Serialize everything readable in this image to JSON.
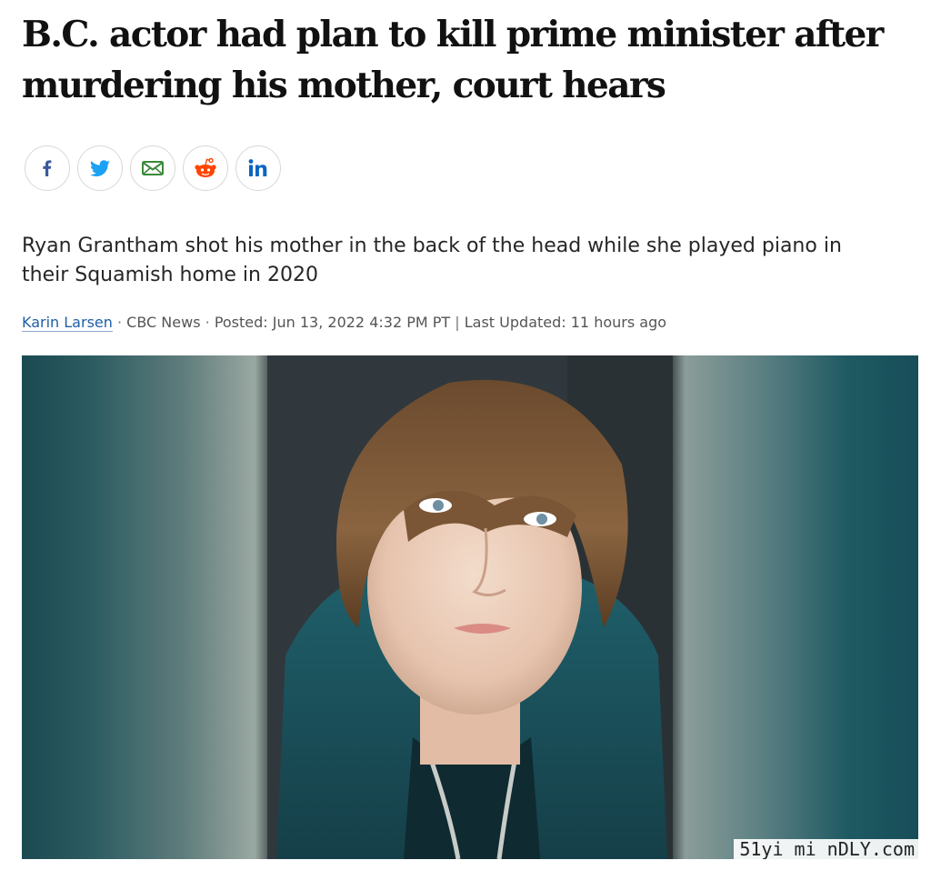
{
  "article": {
    "headline": "B.C. actor had plan to kill prime minister after murdering his mother, court hears",
    "dek": "Ryan Grantham shot his mother in the back of the head while she played piano in their Squamish home in 2020",
    "byline": {
      "author": "Karin Larsen",
      "separator_dot": "·",
      "source": "CBC News",
      "posted": "Posted: Jun 13, 2022 4:32 PM PT",
      "pipe": "|",
      "updated": "Last Updated: 11 hours ago"
    }
  },
  "share": {
    "buttons": [
      {
        "network": "facebook",
        "icon": "facebook-icon",
        "color": "#3b5998"
      },
      {
        "network": "twitter",
        "icon": "twitter-icon",
        "color": "#1da1f2"
      },
      {
        "network": "email",
        "icon": "email-icon",
        "color": "#3a8a3a"
      },
      {
        "network": "reddit",
        "icon": "reddit-icon",
        "color": "#ff4500"
      },
      {
        "network": "linkedin",
        "icon": "linkedin-icon",
        "color": "#0a66c2"
      }
    ]
  },
  "hero_image": {
    "subject": "portrait-photo",
    "watermark": "51yi mi nDLY.com"
  },
  "colors": {
    "headline": "#111111",
    "author_link": "#1f5fa8",
    "meta_text": "#555555",
    "share_border": "#d8d8d8"
  }
}
